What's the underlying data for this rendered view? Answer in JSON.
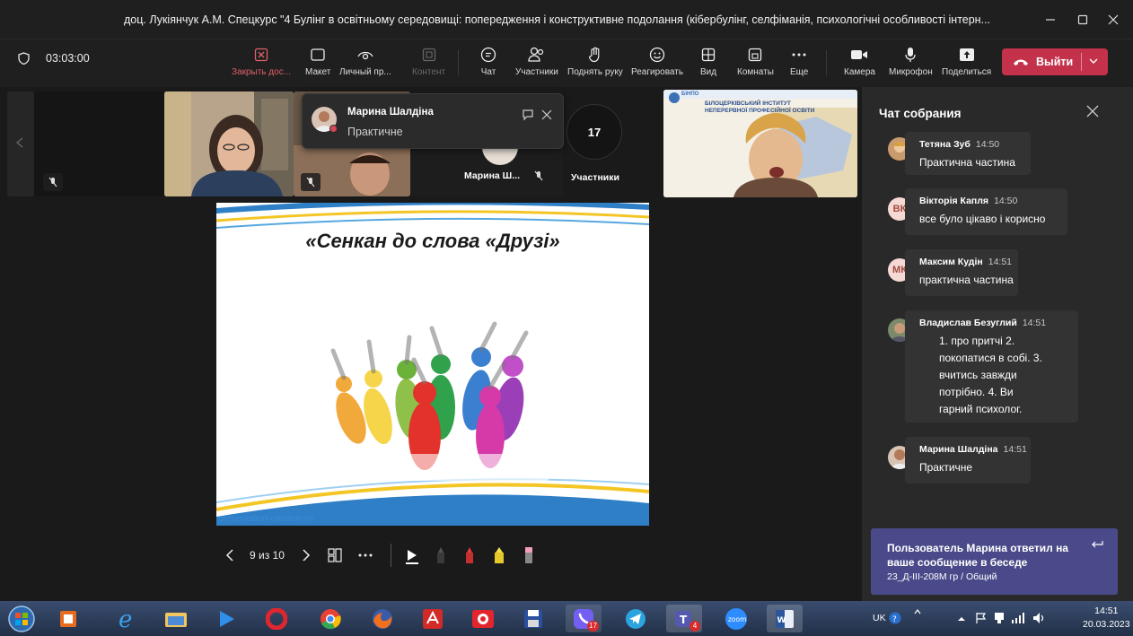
{
  "window": {
    "title": "доц. Лукіянчук А.М. Спецкурс \"4 Булінг в освітньому середовищі: попередження і конструктивне подолання (кібербулінг, селфіманія, психологічні особливості інтерн..."
  },
  "toolbar": {
    "timer": "03:03:00",
    "buttons": [
      {
        "label": "Закрыть дос...",
        "icon": "close-box-icon"
      },
      {
        "label": "Макет",
        "icon": "layout-icon"
      },
      {
        "label": "Личный пр...",
        "icon": "eye-icon"
      },
      {
        "label": "Контент",
        "icon": "content-icon"
      },
      {
        "label": "Чат",
        "icon": "chat-icon"
      },
      {
        "label": "Участники",
        "icon": "people-icon"
      },
      {
        "label": "Поднять руку",
        "icon": "hand-icon"
      },
      {
        "label": "Реагировать",
        "icon": "smiley-icon"
      },
      {
        "label": "Вид",
        "icon": "grid-icon"
      },
      {
        "label": "Комнаты",
        "icon": "rooms-icon"
      },
      {
        "label": "Еще",
        "icon": "more-icon"
      },
      {
        "label": "Камера",
        "icon": "camera-icon"
      },
      {
        "label": "Микрофон",
        "icon": "mic-icon"
      },
      {
        "label": "Поделиться",
        "icon": "share-icon"
      }
    ],
    "leave_label": "Выйти"
  },
  "stage": {
    "toast": {
      "name": "Марина Шалдіна",
      "message": "Практичне"
    },
    "participant_tile_name": "Марина Ш...",
    "participants_count": "17",
    "participants_label": "Участники",
    "banner_title": "БІЛОЦЕРКІВСЬКИЙ ІНСТИТУТ НЕПЕРЕРВНОЇ ПРОФЕСІЙНОЇ ОСВІТИ",
    "banner_logo": "БІНПО"
  },
  "slide": {
    "title": "«Сенкан до слова «Друзі»",
    "footer": "presentation-creation.ru",
    "nav": {
      "position": "9 из 10"
    }
  },
  "chat": {
    "header": "Чат собрания",
    "messages": [
      {
        "author": "Тетяна Зуб",
        "time": "14:50",
        "lines": [
          "Практична частина"
        ],
        "avatar": "photo",
        "status": "busy"
      },
      {
        "author": "Вікторія Капля",
        "time": "14:50",
        "lines": [
          "все було цікаво і корисно"
        ],
        "avatar": "ВК",
        "status": "available"
      },
      {
        "author": "Максим Кудін",
        "time": "14:51",
        "lines": [
          "практична частина"
        ],
        "avatar": "МК",
        "status": "busy"
      },
      {
        "author": "Владислав Безуглий",
        "time": "14:51",
        "lines": [
          "1. про притчі 2.",
          "покопатися в собі. 3.",
          "вчитись завжди",
          "потрібно. 4. Ви",
          "гарний психолог."
        ],
        "avatar": "photo",
        "status": "available"
      },
      {
        "author": "Марина Шалдіна",
        "time": "14:51",
        "lines": [
          "Практичне"
        ],
        "avatar": "photo",
        "status": "busy"
      }
    ],
    "notification": {
      "text": "Пользователь Марина ответил на ваше сообщение в беседе",
      "channel": "23_Д-ІІІ-208М гр / Общий"
    }
  },
  "taskbar": {
    "lang": "UK",
    "time": "14:51",
    "date": "20.03.2023",
    "badges": {
      "viber": "17",
      "teams": "4"
    }
  },
  "colors": {
    "accent_red": "#c4314b",
    "notification": "#4a4a8a",
    "available": "#6bb700",
    "busy": "#d74654"
  }
}
